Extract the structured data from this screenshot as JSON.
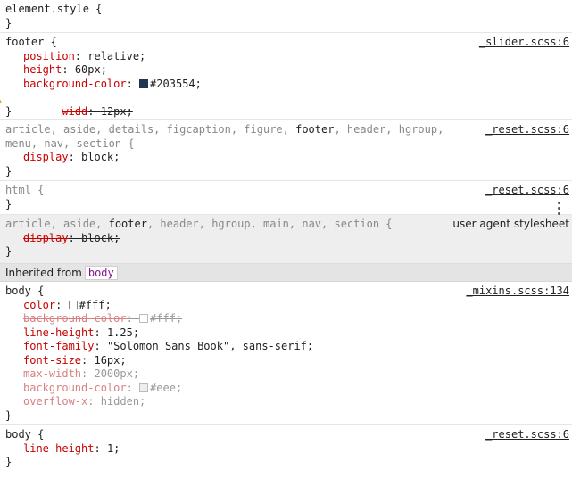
{
  "rules": {
    "element_style": {
      "selector": "element.style {",
      "close": "}"
    },
    "footer": {
      "selector": "footer {",
      "source": "_slider.scss:6",
      "close": "}",
      "decls": [
        {
          "prop": "position",
          "value": "relative;"
        },
        {
          "prop": "height",
          "value": "60px;"
        },
        {
          "prop": "background-color",
          "value": "#203554;",
          "swatch": "#203554"
        },
        {
          "prop": "widd",
          "value": "12px;"
        }
      ]
    },
    "reset_block": {
      "sel_dim1": "article, aside, details, figcaption, figure, ",
      "sel_match": "footer",
      "sel_dim2": ", header, hgroup,",
      "sel_line2": "menu, nav, section {",
      "source": "_reset.scss:6",
      "close": "}",
      "decls": [
        {
          "prop": "display",
          "value": "block;"
        }
      ]
    },
    "html": {
      "selector": "html {",
      "source": "_reset.scss:6",
      "close": "}"
    },
    "ua": {
      "sel_dim1": "article, aside, ",
      "sel_match": "footer",
      "sel_dim2": ", header, hgroup, main, nav, section {",
      "source": "user agent stylesheet",
      "close": "}",
      "decls": [
        {
          "prop": "display",
          "value": "block;"
        }
      ]
    },
    "body_mixins": {
      "selector": "body {",
      "source": "_mixins.scss:134",
      "close": "}",
      "decls": [
        {
          "prop": "color",
          "value": "#fff;",
          "swatch": "#ffffff"
        },
        {
          "prop": "background-color",
          "value": "#fff;",
          "swatch": "#ffffff"
        },
        {
          "prop": "line-height",
          "value": "1.25;"
        },
        {
          "prop": "font-family",
          "value": "\"Solomon Sans Book\", sans-serif;"
        },
        {
          "prop": "font-size",
          "value": "16px;"
        },
        {
          "prop": "max-width",
          "value": "2000px;"
        },
        {
          "prop": "background-color",
          "value": "#eee;",
          "swatch": "#eeeeee"
        },
        {
          "prop": "overflow-x",
          "value": "hidden;"
        }
      ]
    },
    "body_reset": {
      "selector": "body {",
      "source": "_reset.scss:6",
      "close": "}",
      "decls": [
        {
          "prop": "line-height",
          "value": "1;"
        }
      ]
    }
  },
  "inherited": {
    "label": "Inherited from",
    "tag": "body"
  },
  "colors": {
    "prop": "#c80000",
    "ua_bg": "#eeeeee",
    "inherited_bg": "#e4e4e4",
    "swatch_footer": "#203554"
  },
  "icons": [
    "warning-icon",
    "more-options-icon"
  ]
}
